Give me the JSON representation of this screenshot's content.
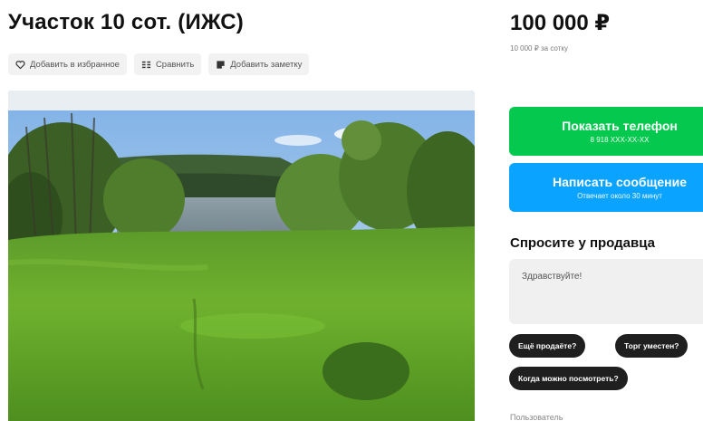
{
  "listing": {
    "title": "Участок 10 сот. (ИЖС)",
    "price": "100 000 ₽",
    "price_per_unit": "10 000 ₽ за сотку"
  },
  "actions": [
    {
      "label": "Добавить в избранное",
      "icon": "heart-icon"
    },
    {
      "label": "Сравнить",
      "icon": "compare-icon"
    },
    {
      "label": "Добавить заметку",
      "icon": "note-icon"
    }
  ],
  "contact": {
    "show_phone_label": "Показать телефон",
    "phone_masked": "8 918 XXX-XX-XX",
    "write_message_label": "Написать сообщение",
    "response_time": "Отвечает около 30 минут"
  },
  "ask_seller": {
    "title": "Спросите у продавца",
    "message_value": "Здравствуйте!",
    "quick_questions": [
      "Ещё продаёте?",
      "Торг уместен?",
      "Когда можно посмотреть?"
    ]
  },
  "seller": {
    "label": "Пользователь"
  },
  "colors": {
    "phone_button": "#05c84e",
    "message_button": "#0aa3ff",
    "chip_background": "#1f1f1f",
    "action_background": "#f2f2f2"
  }
}
